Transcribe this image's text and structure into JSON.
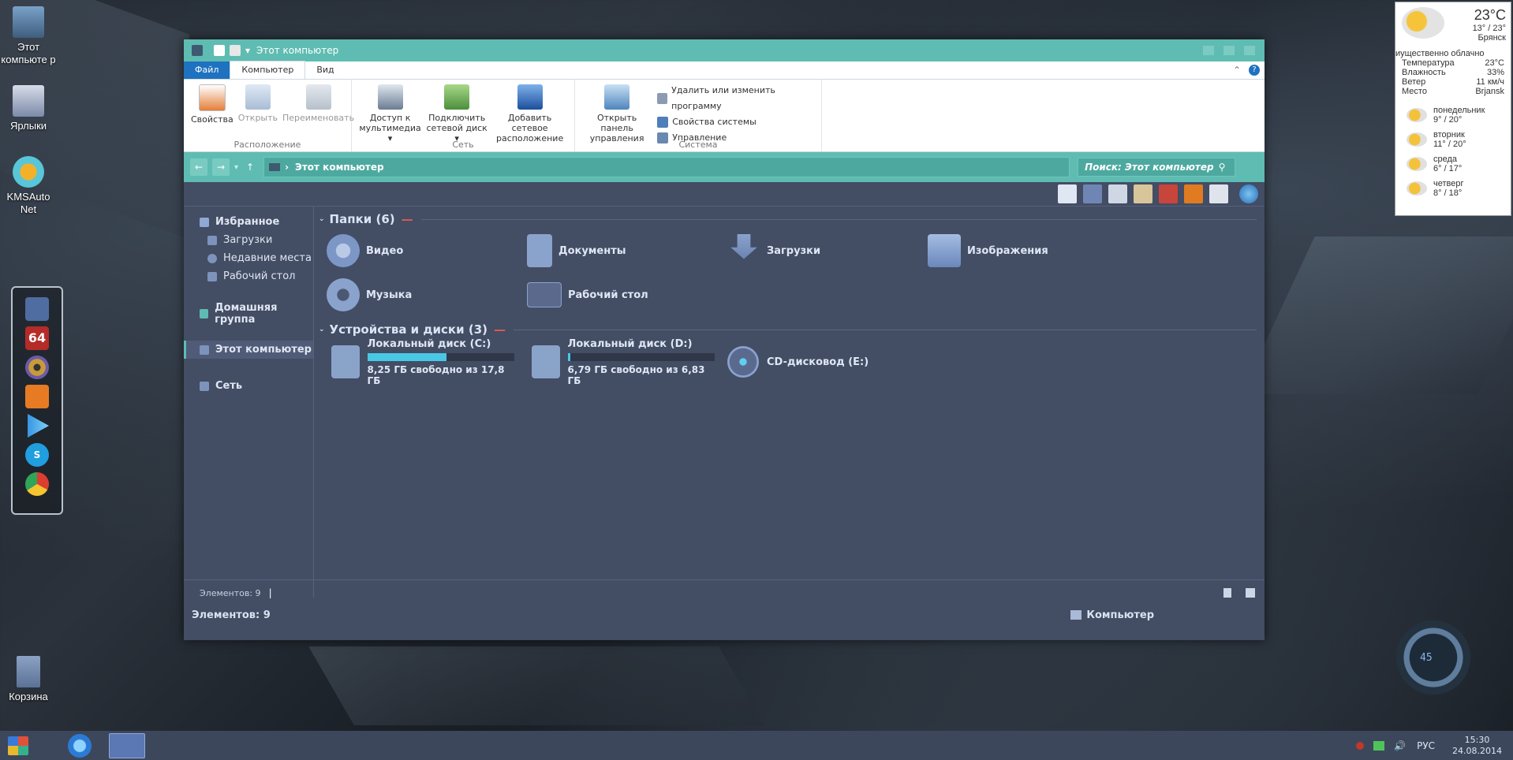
{
  "desktop": {
    "icons": [
      {
        "label": "Этот компьюте р",
        "icon": "computer-icon"
      },
      {
        "label": "Ярлыки",
        "icon": "folder-icon"
      },
      {
        "label": "KMSAuto Net",
        "icon": "key-icon"
      },
      {
        "label": "Корзина",
        "icon": "recycle-bin-icon"
      }
    ]
  },
  "weather": {
    "temp": "23°C",
    "range": "13° / 23°",
    "city": "Брянск",
    "condition": "иущественно облачно",
    "details": [
      {
        "k": "Температура",
        "v": "23°C"
      },
      {
        "k": "Влажность",
        "v": "33%"
      },
      {
        "k": "Ветер",
        "v": "11 км/ч"
      },
      {
        "k": "Место",
        "v": "Brjansk"
      }
    ],
    "days": [
      {
        "day": "понедельник",
        "temps": "9° / 20°"
      },
      {
        "day": "вторник",
        "temps": "11° / 20°"
      },
      {
        "day": "среда",
        "temps": "6° / 17°"
      },
      {
        "day": "четверг",
        "temps": "8° / 18°"
      }
    ]
  },
  "window": {
    "title": "Этот компьютер",
    "tabs": [
      "Файл",
      "Компьютер",
      "Вид"
    ],
    "ribbon": {
      "location": {
        "name": "Расположение",
        "buttons": [
          "Свойства",
          "Открыть",
          "Переименовать"
        ]
      },
      "network": {
        "name": "Сеть",
        "b1a": "Доступ к",
        "b1b": "мультимедиа ▾",
        "b2a": "Подключить",
        "b2b": "сетевой диск ▾",
        "b3a": "Добавить сетевое",
        "b3b": "расположение"
      },
      "system": {
        "name": "Система",
        "open_a": "Открыть панель",
        "open_b": "управления",
        "small": [
          "Удалить или изменить программу",
          "Свойства системы",
          "Управление"
        ]
      }
    },
    "address": "Этот компьютер",
    "search_placeholder": "Поиск: Этот компьютер",
    "nav": {
      "favorites": "Избранное",
      "fav_items": [
        "Загрузки",
        "Недавние места",
        "Рабочий стол"
      ],
      "homegroup": "Домашняя группа",
      "this_pc": "Этот компьютер",
      "network": "Сеть"
    },
    "folders_header": "Папки (6)",
    "folders": [
      "Видео",
      "Документы",
      "Загрузки",
      "Изображения",
      "Музыка",
      "Рабочий стол"
    ],
    "drives_header": "Устройства и диски (3)",
    "drives": [
      {
        "name": "Локальный диск (C:)",
        "free": "8,25 ГБ свободно из 17,8 ГБ",
        "used_fraction": 0.54
      },
      {
        "name": "Локальный диск (D:)",
        "free": "6,79 ГБ свободно из 6,83 ГБ",
        "used_fraction": 0.01
      },
      {
        "name": "CD-дисковод (E:)"
      }
    ],
    "status_small": "Элементов: 9",
    "status_big": "Элементов: 9",
    "status_right": "Компьютер"
  },
  "taskbar": {
    "lang": "РУС",
    "time": "15:30",
    "date": "24.08.2014"
  },
  "quicklaunch_badge": "64",
  "gauge_value": "45"
}
